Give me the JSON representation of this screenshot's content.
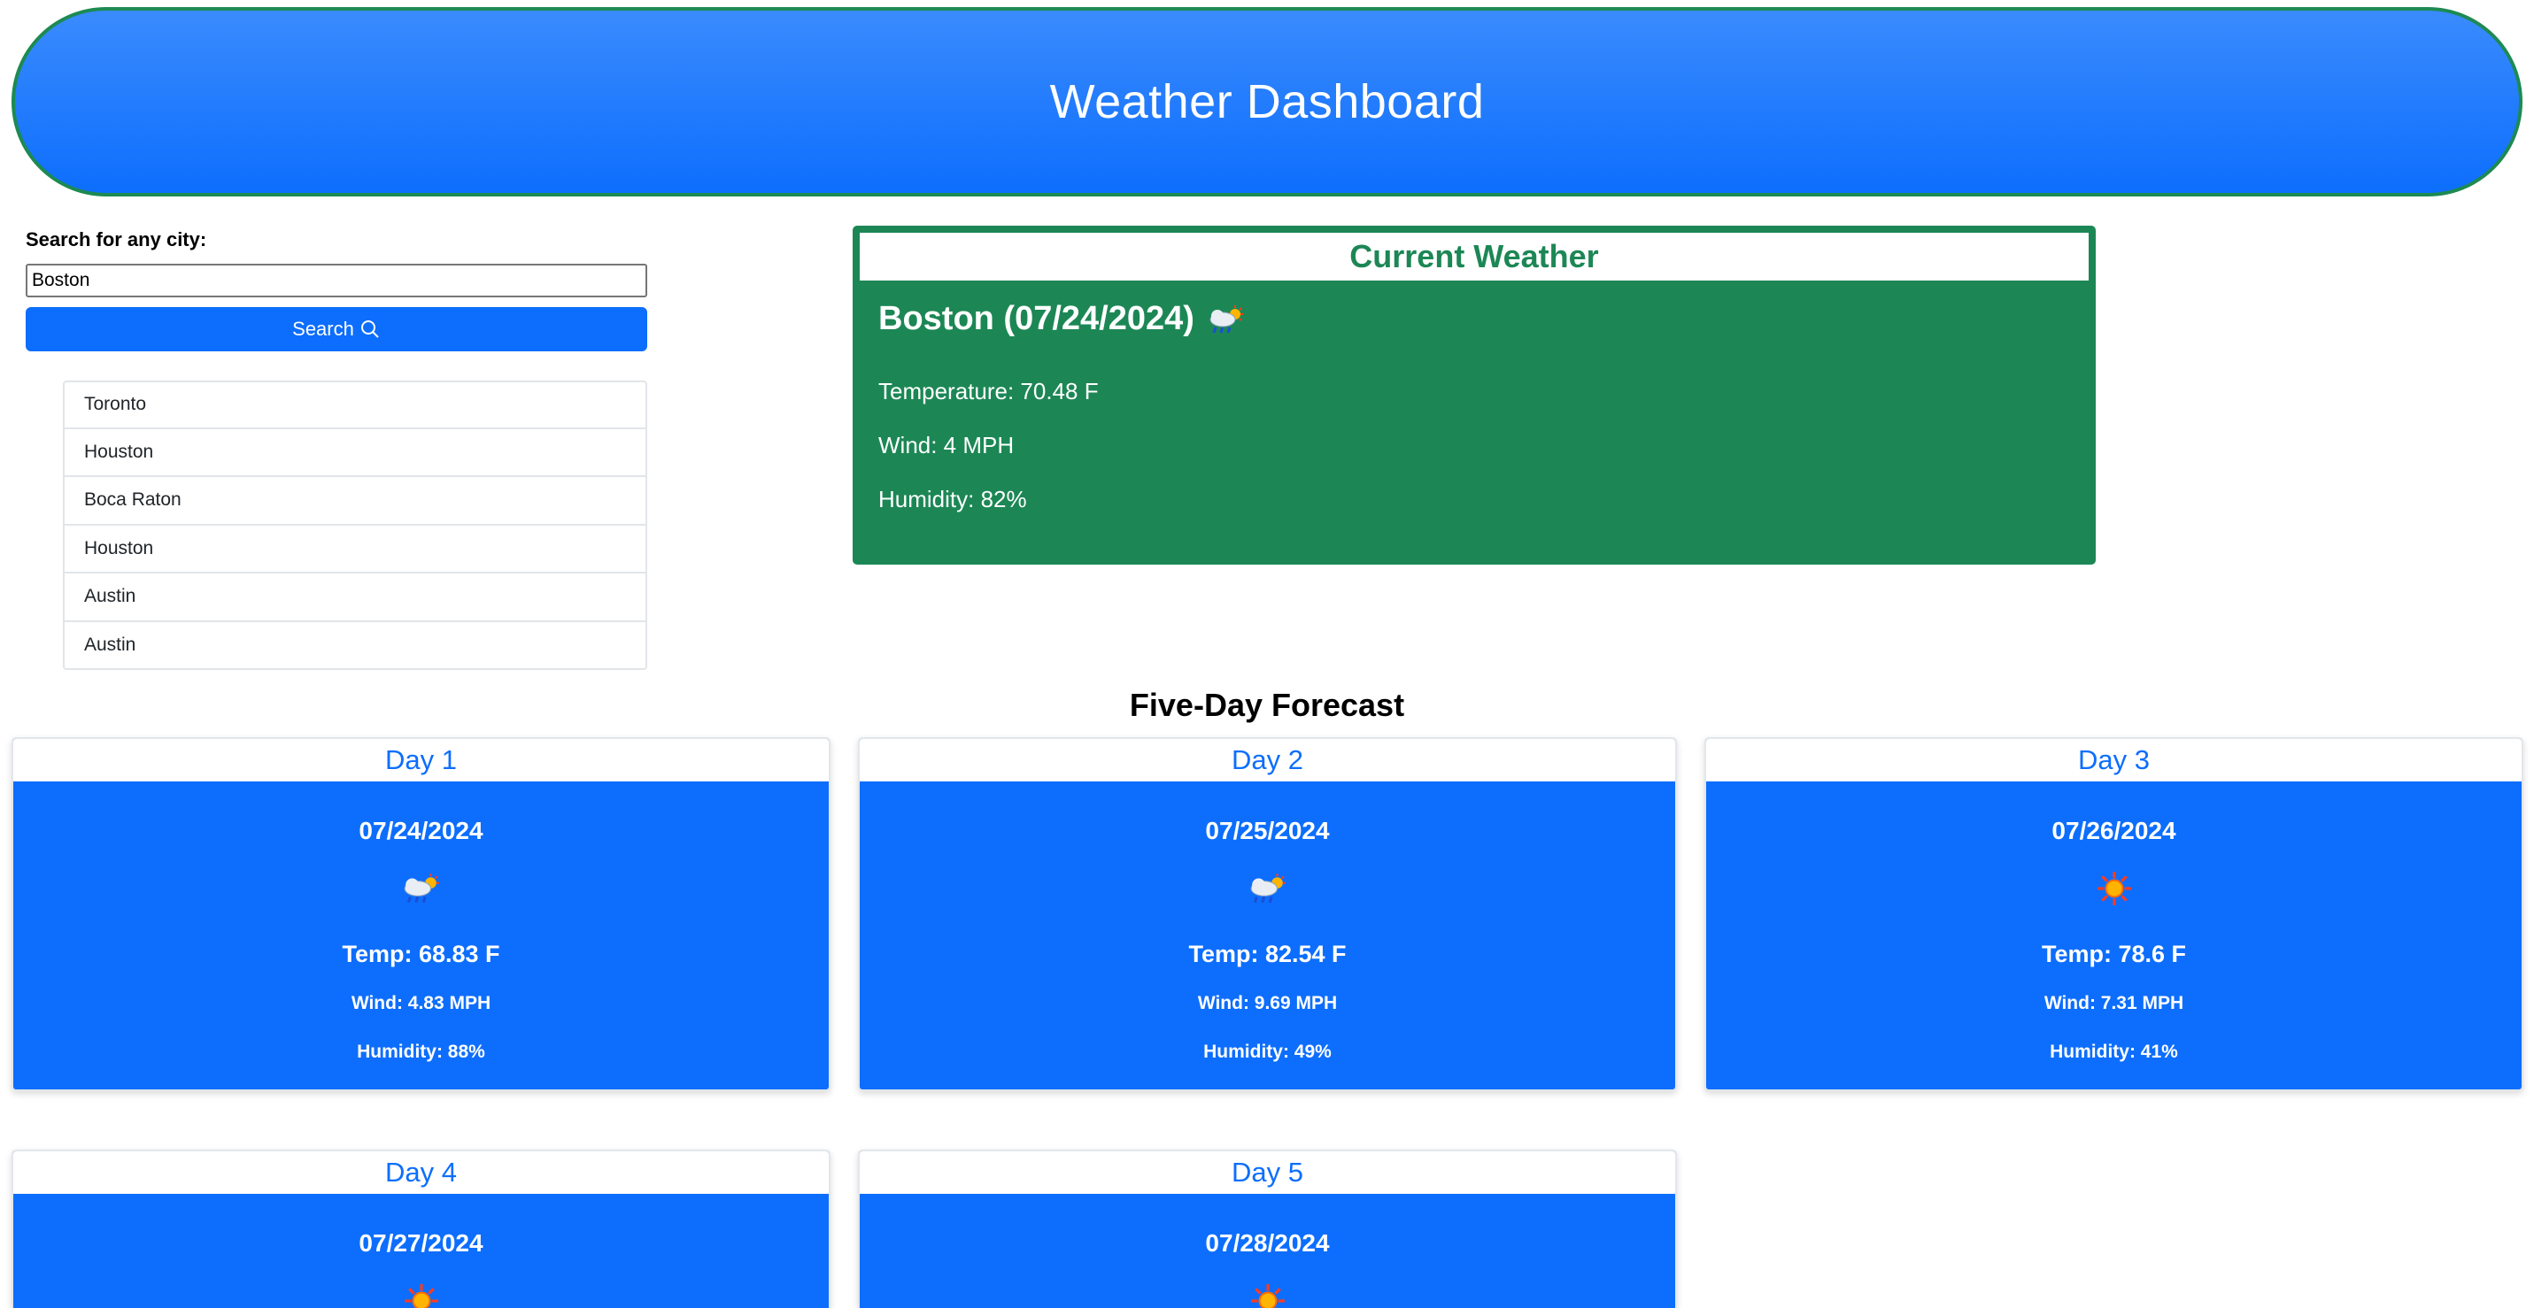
{
  "header": {
    "title": "Weather Dashboard"
  },
  "search": {
    "label": "Search for any city:",
    "value": "Boston",
    "button_label": "Search"
  },
  "history": [
    "Toronto",
    "Houston",
    "Boca Raton",
    "Houston",
    "Austin",
    "Austin"
  ],
  "current": {
    "panel_title": "Current Weather",
    "city_date": "Boston (07/24/2024)",
    "icon": "cloud-rain-sun-icon",
    "temperature": "Temperature: 70.48 F",
    "wind": "Wind: 4 MPH",
    "humidity": "Humidity: 82%"
  },
  "forecast": {
    "title": "Five-Day Forecast",
    "days": [
      {
        "label": "Day 1",
        "date": "07/24/2024",
        "icon": "cloud-rain-sun-icon",
        "temp": "Temp: 68.83 F",
        "wind": "Wind: 4.83 MPH",
        "humidity": "Humidity: 88%"
      },
      {
        "label": "Day 2",
        "date": "07/25/2024",
        "icon": "cloud-rain-sun-icon",
        "temp": "Temp: 82.54 F",
        "wind": "Wind: 9.69 MPH",
        "humidity": "Humidity: 49%"
      },
      {
        "label": "Day 3",
        "date": "07/26/2024",
        "icon": "sun-icon",
        "temp": "Temp: 78.6 F",
        "wind": "Wind: 7.31 MPH",
        "humidity": "Humidity: 41%"
      },
      {
        "label": "Day 4",
        "date": "07/27/2024",
        "icon": "sun-icon"
      },
      {
        "label": "Day 5",
        "date": "07/28/2024",
        "icon": "sun-icon"
      }
    ]
  },
  "colors": {
    "primary": "#0d6efd",
    "success": "#1c8755",
    "header_border": "#1d8a52"
  }
}
